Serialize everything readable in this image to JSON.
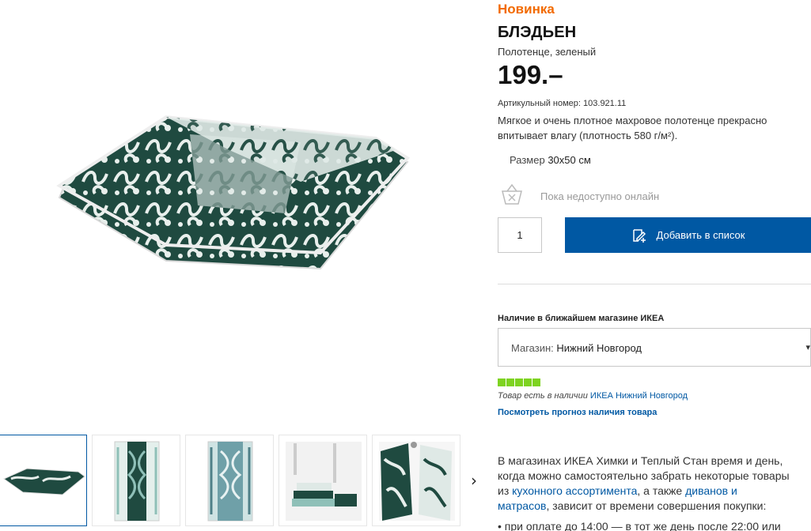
{
  "product": {
    "badge": "Новинка",
    "name": "БЛЭДЬЕН",
    "short_desc": "Полотенце, зеленый",
    "price": "199.–",
    "article_label": "Артикульный номер:",
    "article_number": "103.921.11",
    "long_desc_line1": "Мягкое и очень плотное махровое полотенце прекрасно",
    "long_desc_line2": "впитывает влагу (плотность 580 г/м²).",
    "size_label": "Размер",
    "size_value": "30x50 см"
  },
  "purchase": {
    "unavailable_text": "Пока недоступно онлайн",
    "quantity": "1",
    "add_button_label": "Добавить в список"
  },
  "availability": {
    "heading": "Наличие в ближайшем магазине ИКЕА",
    "store_label": "Магазин:",
    "store_value": "Нижний Новгород",
    "stock_level": 1.0,
    "stock_text": "Товар есть в наличии",
    "stock_store_link": "ИКЕА Нижний Новгород",
    "forecast_link": "Посмотреть прогноз наличия товара"
  },
  "delivery": {
    "line1": "В магазинах ИКЕА Химки и Теплый Стан время и день,",
    "line2": "когда можно самостоятельно забрать некоторые товары",
    "line3_pre": "из ",
    "line3_link": "кухонного ассортимента",
    "line3_mid": ", а также ",
    "line3_link2": "диванов и",
    "line4_link": "матрасов",
    "line4_post": ", зависит от времени совершения покупки:",
    "bullet1": "• при оплате до 14:00 — в тот же день после 22:00 или"
  },
  "colors": {
    "accent_orange": "#f26a00",
    "primary_blue": "#0058a3",
    "stock_green": "#7ed321",
    "towel_dark": "#1f4a40",
    "towel_light": "#8fc0b8"
  },
  "thumbnails": [
    "folded-towel",
    "towel-pattern-green",
    "towel-pattern-blue",
    "towels-stack-bathroom",
    "towels-hanging"
  ]
}
